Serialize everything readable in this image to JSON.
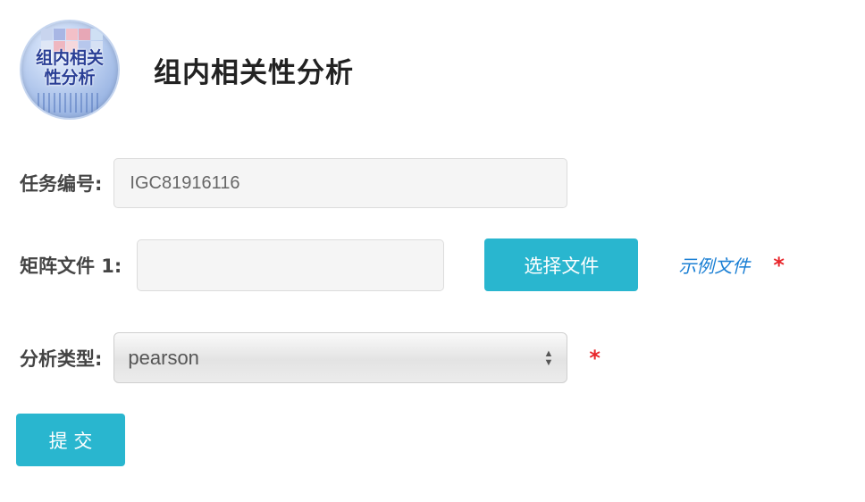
{
  "header": {
    "logo_text_line1": "组内相关",
    "logo_text_line2": "性分析",
    "title": "组内相关性分析"
  },
  "form": {
    "task_id": {
      "label": "任务编号:",
      "value": "IGC81916116"
    },
    "matrix_file": {
      "label": "矩阵文件 1:",
      "value": "",
      "choose_button": "选择文件",
      "example_link": "示例文件",
      "required_mark": "*"
    },
    "analysis_type": {
      "label": "分析类型:",
      "selected": "pearson",
      "required_mark": "*"
    },
    "submit_label": "提 交"
  },
  "colors": {
    "accent": "#29b6cf",
    "link": "#1a7fd4",
    "required": "#e8262b"
  },
  "icons": {
    "select_arrows": "up-down-chevron-icon"
  }
}
